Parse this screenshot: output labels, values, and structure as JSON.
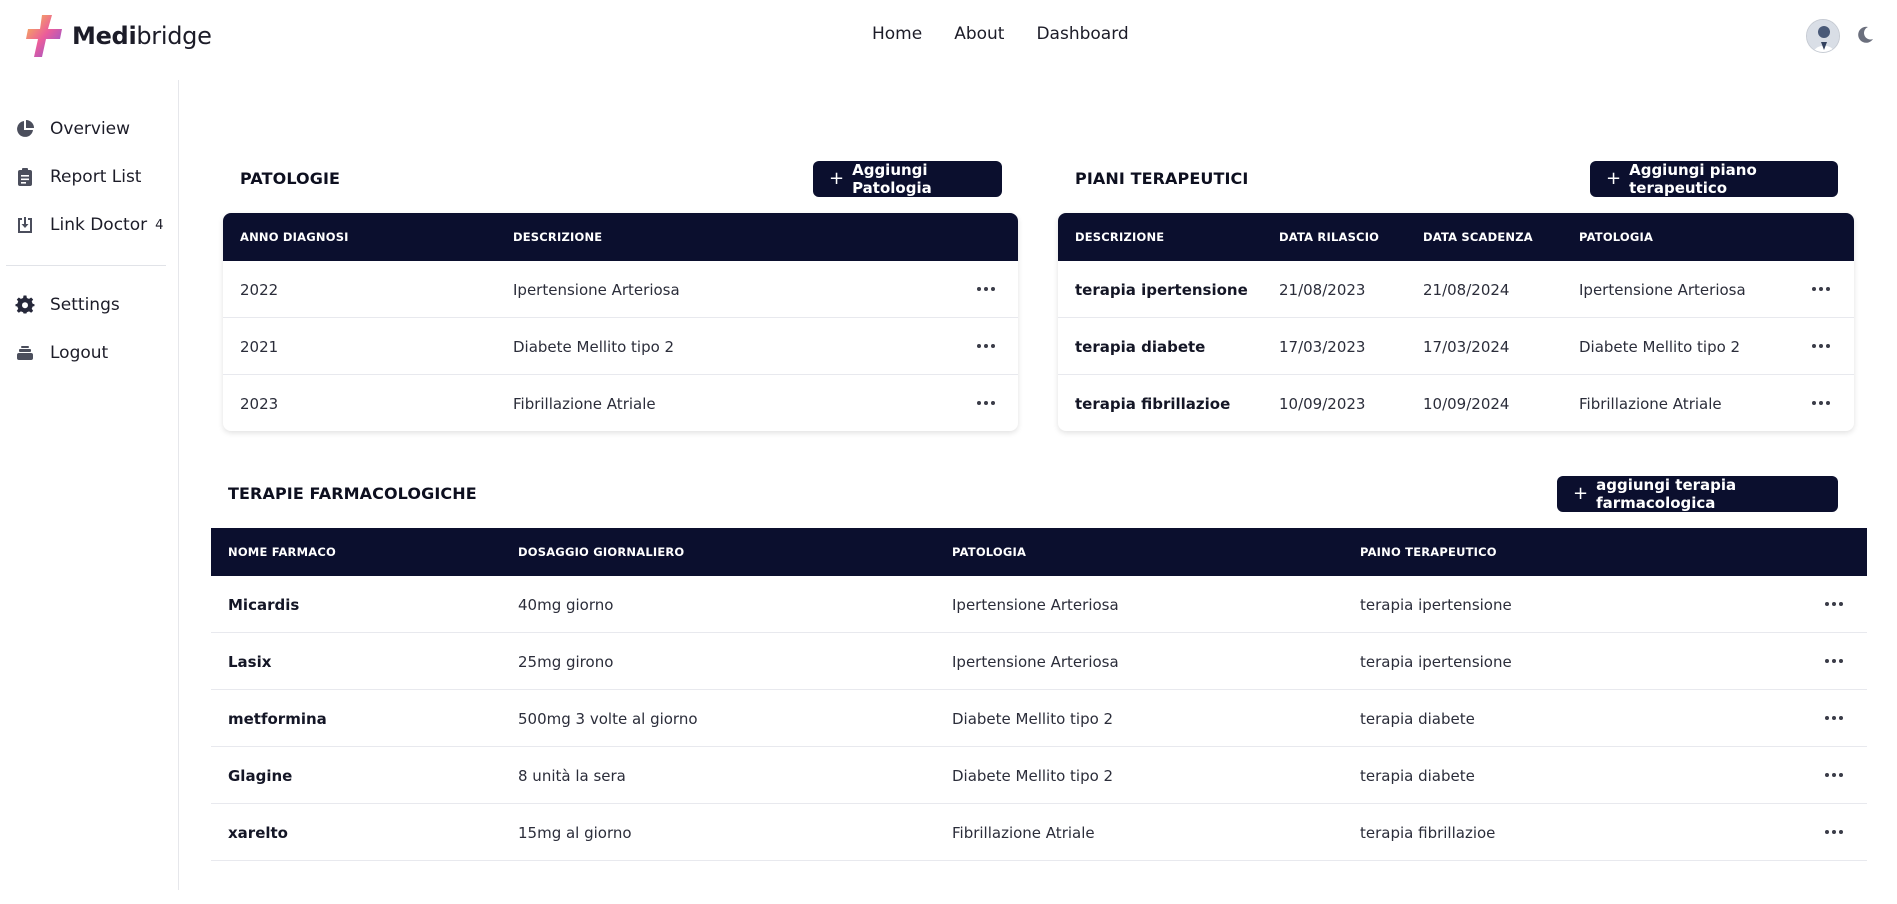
{
  "brand": {
    "name_bold": "Medi",
    "name_rest": "bridge"
  },
  "topnav": [
    "Home",
    "About",
    "Dashboard"
  ],
  "sidebar": {
    "items": [
      {
        "label": "Overview",
        "icon": "pie-chart-icon"
      },
      {
        "label": "Report List",
        "icon": "clipboard-icon"
      },
      {
        "label": "Link Doctor",
        "icon": "download-tray-icon",
        "count": "4"
      },
      {
        "label": "Settings",
        "icon": "gear-icon"
      },
      {
        "label": "Logout",
        "icon": "logout-icon"
      }
    ]
  },
  "patologie": {
    "title": "PATOLOGIE",
    "add_label": "Aggiungi Patologia",
    "columns": [
      "ANNO DIAGNOSI",
      "DESCRIZIONE"
    ],
    "rows": [
      [
        "2022",
        "Ipertensione Arteriosa"
      ],
      [
        "2021",
        "Diabete Mellito tipo 2"
      ],
      [
        "2023",
        "Fibrillazione Atriale"
      ]
    ]
  },
  "piani": {
    "title": "PIANI TERAPEUTICI",
    "add_label": "Aggiungi piano terapeutico",
    "columns": [
      "DESCRIZIONE",
      "DATA RILASCIO",
      "DATA SCADENZA",
      "PATOLOGIA"
    ],
    "rows": [
      [
        "terapia ipertensione",
        "21/08/2023",
        "21/08/2024",
        "Ipertensione Arteriosa"
      ],
      [
        "terapia diabete",
        "17/03/2023",
        "17/03/2024",
        "Diabete Mellito tipo 2"
      ],
      [
        "terapia fibrillazioe",
        "10/09/2023",
        "10/09/2024",
        "Fibrillazione Atriale"
      ]
    ]
  },
  "terapie": {
    "title": "TERAPIE FARMACOLOGICHE",
    "add_label": "aggiungi terapia farmacologica",
    "columns": [
      "NOME FARMACO",
      "DOSAGGIO GIORNALIERO",
      "PATOLOGIA",
      "PAINO TERAPEUTICO"
    ],
    "rows": [
      [
        "Micardis",
        "40mg giorno",
        "Ipertensione Arteriosa",
        "terapia ipertensione"
      ],
      [
        "Lasix",
        "25mg girono",
        "Ipertensione Arteriosa",
        "terapia ipertensione"
      ],
      [
        "metformina",
        "500mg 3 volte al giorno",
        "Diabete Mellito tipo 2",
        "terapia diabete"
      ],
      [
        "Glagine",
        "8 unità la sera",
        "Diabete Mellito tipo 2",
        "terapia diabete"
      ],
      [
        "xarelto",
        "15mg al giorno",
        "Fibrillazione Atriale",
        "terapia fibrillazioe"
      ]
    ]
  },
  "colors": {
    "navy": "#0b0f2e",
    "accent_logo": [
      "#f5b83d",
      "#e44d9c",
      "#7a4fd8"
    ]
  }
}
